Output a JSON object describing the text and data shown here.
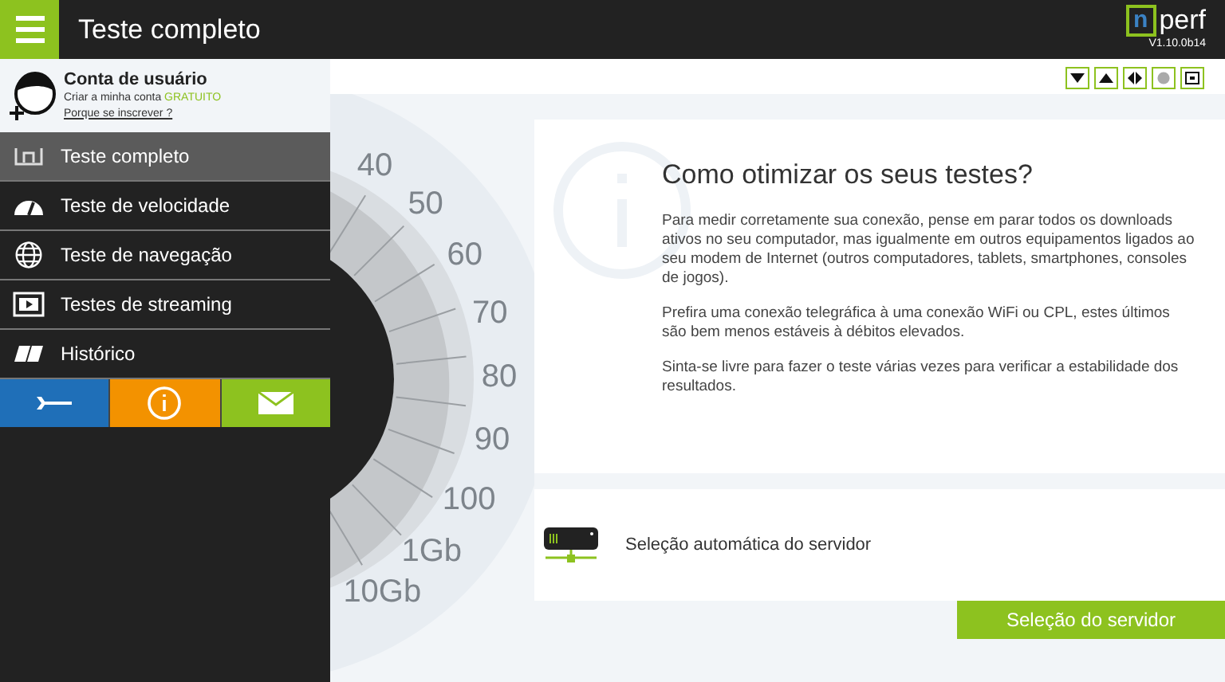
{
  "header": {
    "title": "Teste completo",
    "logo_letter": "n",
    "logo_text": "perf",
    "version": "V1.10.0b14"
  },
  "account": {
    "title": "Conta de usuário",
    "create_text": "Criar a minha conta",
    "create_highlight": "GRATUITO",
    "link": "Porque se inscrever ?"
  },
  "menu": [
    {
      "label": "Teste completo",
      "kind": "nperf",
      "selected": true
    },
    {
      "label": "Teste de velocidade",
      "kind": "speed",
      "selected": false
    },
    {
      "label": "Teste de navegação",
      "kind": "globe",
      "selected": false
    },
    {
      "label": "Testes de streaming",
      "kind": "video",
      "selected": false
    },
    {
      "label": "Histórico",
      "kind": "book",
      "selected": false
    }
  ],
  "actions": [
    {
      "kind": "settings",
      "color": "#1f6fb8"
    },
    {
      "kind": "info",
      "color": "#f39200"
    },
    {
      "kind": "mail",
      "color": "#8dc21f"
    }
  ],
  "gauge": {
    "labels": [
      "40",
      "50",
      "60",
      "70",
      "80",
      "90",
      "100",
      "1Gb",
      "10Gb"
    ]
  },
  "tips": {
    "title": "Como otimizar os seus testes?",
    "paragraphs": [
      "Para medir corretamente sua conexão, pense em parar todos os downloads ativos no seu computador, mas igualmente em outros equipamentos ligados ao seu modem de Internet (outros computadores, tablets, smartphones, consoles de jogos).",
      "Prefira uma conexão telegráfica à uma conexão WiFi ou CPL, estes últimos são bem menos estáveis à débitos elevados.",
      "Sinta-se livre para fazer o teste várias vezes para verificar a estabilidade dos resultados."
    ]
  },
  "server": {
    "label": "Seleção automática do servidor",
    "button": "Seleção do servidor"
  }
}
